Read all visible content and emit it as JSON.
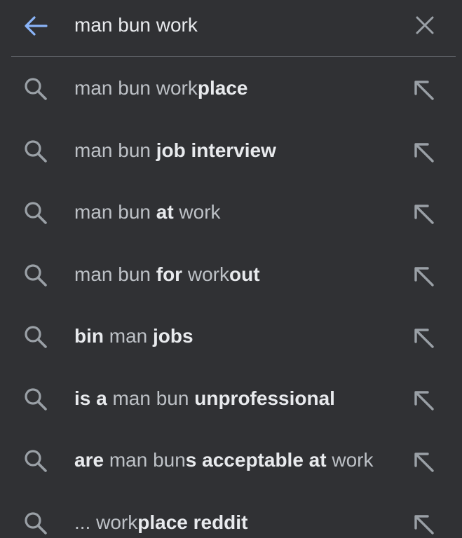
{
  "search": {
    "value": "man bun work",
    "back_icon": "arrow-left-icon",
    "clear_icon": "close-icon"
  },
  "colors": {
    "background": "#303134",
    "accent": "#8ab4f8",
    "icon": "#9aa0a6",
    "text": "#bdc1c6",
    "text_bold": "#e8eaed",
    "divider": "#5f6368"
  },
  "suggestions": [
    {
      "icon": "search-icon",
      "parts": [
        {
          "t": "man bun work",
          "b": false
        },
        {
          "t": "place",
          "b": true
        }
      ],
      "fill_icon": "arrow-up-left-icon"
    },
    {
      "icon": "search-icon",
      "parts": [
        {
          "t": "man bun ",
          "b": false
        },
        {
          "t": "job interview",
          "b": true
        }
      ],
      "fill_icon": "arrow-up-left-icon"
    },
    {
      "icon": "search-icon",
      "parts": [
        {
          "t": "man bun ",
          "b": false
        },
        {
          "t": "at",
          "b": true
        },
        {
          "t": " work",
          "b": false
        }
      ],
      "fill_icon": "arrow-up-left-icon"
    },
    {
      "icon": "search-icon",
      "parts": [
        {
          "t": "man bun ",
          "b": false
        },
        {
          "t": "for",
          "b": true
        },
        {
          "t": " work",
          "b": false
        },
        {
          "t": "out",
          "b": true
        }
      ],
      "fill_icon": "arrow-up-left-icon"
    },
    {
      "icon": "search-icon",
      "parts": [
        {
          "t": "bin",
          "b": true
        },
        {
          "t": " man ",
          "b": false
        },
        {
          "t": "jobs",
          "b": true
        }
      ],
      "fill_icon": "arrow-up-left-icon"
    },
    {
      "icon": "search-icon",
      "parts": [
        {
          "t": "is a",
          "b": true
        },
        {
          "t": " man bun ",
          "b": false
        },
        {
          "t": "unprofessional",
          "b": true
        }
      ],
      "fill_icon": "arrow-up-left-icon"
    },
    {
      "icon": "search-icon",
      "parts": [
        {
          "t": "are",
          "b": true
        },
        {
          "t": " man bun",
          "b": false
        },
        {
          "t": "s acceptable at",
          "b": true
        },
        {
          "t": " work",
          "b": false
        }
      ],
      "fill_icon": "arrow-up-left-icon"
    },
    {
      "icon": "search-icon",
      "parts": [
        {
          "t": "... work",
          "b": false
        },
        {
          "t": "place reddit",
          "b": true
        }
      ],
      "fill_icon": "arrow-up-left-icon"
    }
  ]
}
